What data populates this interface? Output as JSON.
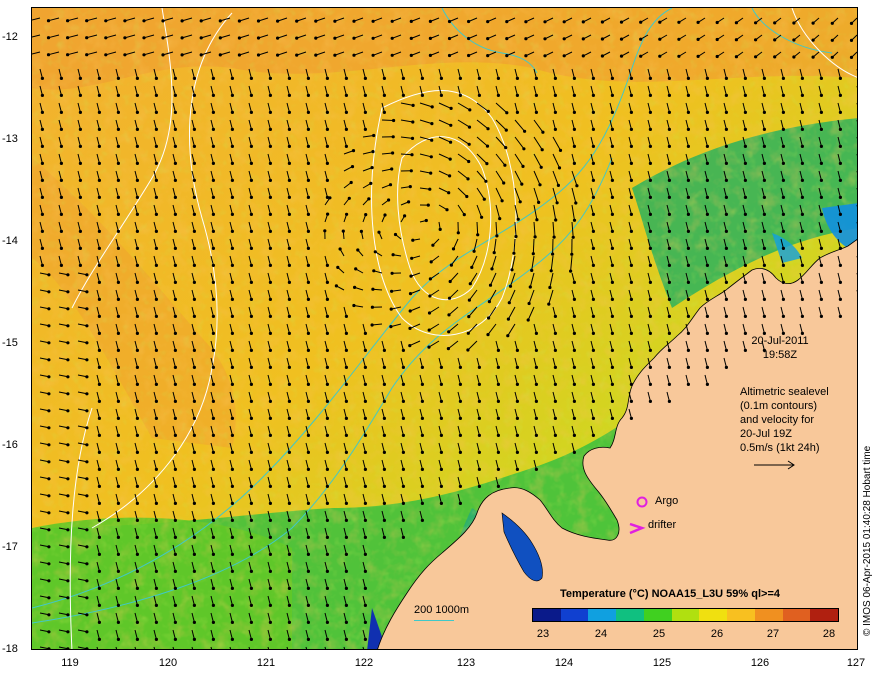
{
  "map": {
    "lat_ticks": [
      "-12",
      "-13",
      "-14",
      "-15",
      "-16",
      "-17",
      "-18"
    ],
    "lon_ticks": [
      "119",
      "120",
      "121",
      "122",
      "123",
      "124",
      "125",
      "126",
      "127"
    ],
    "colors": {
      "land": "#f8c89a",
      "sst_low": "#0a1a8a",
      "sst_high": "#b02010",
      "contour": "#ffffff",
      "isobath": "#40c8c8",
      "arrow": "#000000",
      "markers": "#e020e0"
    }
  },
  "annotations": {
    "date": "20-Jul-2011",
    "time": "19:58Z",
    "alti_lines": [
      "Altimetric sealevel",
      "(0.1m contours)",
      "and velocity for",
      "20-Jul 19Z",
      "0.5m/s (1kt 24h)"
    ],
    "argo_label": "Argo",
    "drifter_label": "drifter",
    "credit": "© IMOS 06-Apr-2015 01:40:28 Hobart time"
  },
  "scale_bar": {
    "label": "200  1000m"
  },
  "colorbar": {
    "title": "Temperature (°C) NOAA15_L3U 59% ql>=4",
    "labels": [
      "23",
      "24",
      "25",
      "26",
      "27",
      "28"
    ],
    "stops": [
      "#0a1a8a",
      "#1040d0",
      "#10a0e0",
      "#10c080",
      "#40d020",
      "#b0e010",
      "#f0e010",
      "#f8c020",
      "#f09020",
      "#e06020",
      "#b02010"
    ]
  }
}
